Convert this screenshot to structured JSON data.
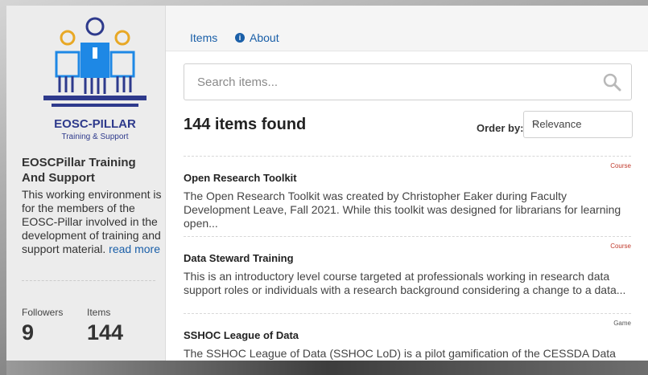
{
  "sidebar": {
    "logo_text": "EOSC-PILLAR",
    "logo_subtext": "Training & Support",
    "org_title": "EOSCPillar Training And Support",
    "org_description": "This working environment is for the members of the EOSC-Pillar involved in the development of training and support material.",
    "read_more": "read more",
    "stats": {
      "followers_label": "Followers",
      "followers_value": "9",
      "items_label": "Items",
      "items_value": "144"
    }
  },
  "nav": {
    "tab_items": "Items",
    "tab_about": "About"
  },
  "search": {
    "placeholder": "Search items..."
  },
  "results": {
    "count_text": "144 items found",
    "order_label": "Order by:",
    "order_value": "Relevance"
  },
  "items": [
    {
      "type": "Course",
      "title": "Open Research Toolkit",
      "description": "The Open Research Toolkit was created by Christopher Eaker during Faculty Development Leave, Fall 2021. While this toolkit was designed for librarians for learning open..."
    },
    {
      "type": "Course",
      "title": "Data Steward Training",
      "description": "This is an introductory level course targeted at professionals working in research data support roles or individuals with a research background considering a change to a data..."
    },
    {
      "type": "Game",
      "title": "SSHOC League of Data",
      "description": "The SSHOC League of Data (SSHOC LoD) is a pilot gamification of the CESSDA Data"
    }
  ],
  "colors": {
    "link": "#1a5fa8",
    "logo_navy": "#2e3a8c",
    "logo_gold": "#e8a825",
    "logo_blue": "#1e88e5",
    "type_label": "#c0392b"
  }
}
